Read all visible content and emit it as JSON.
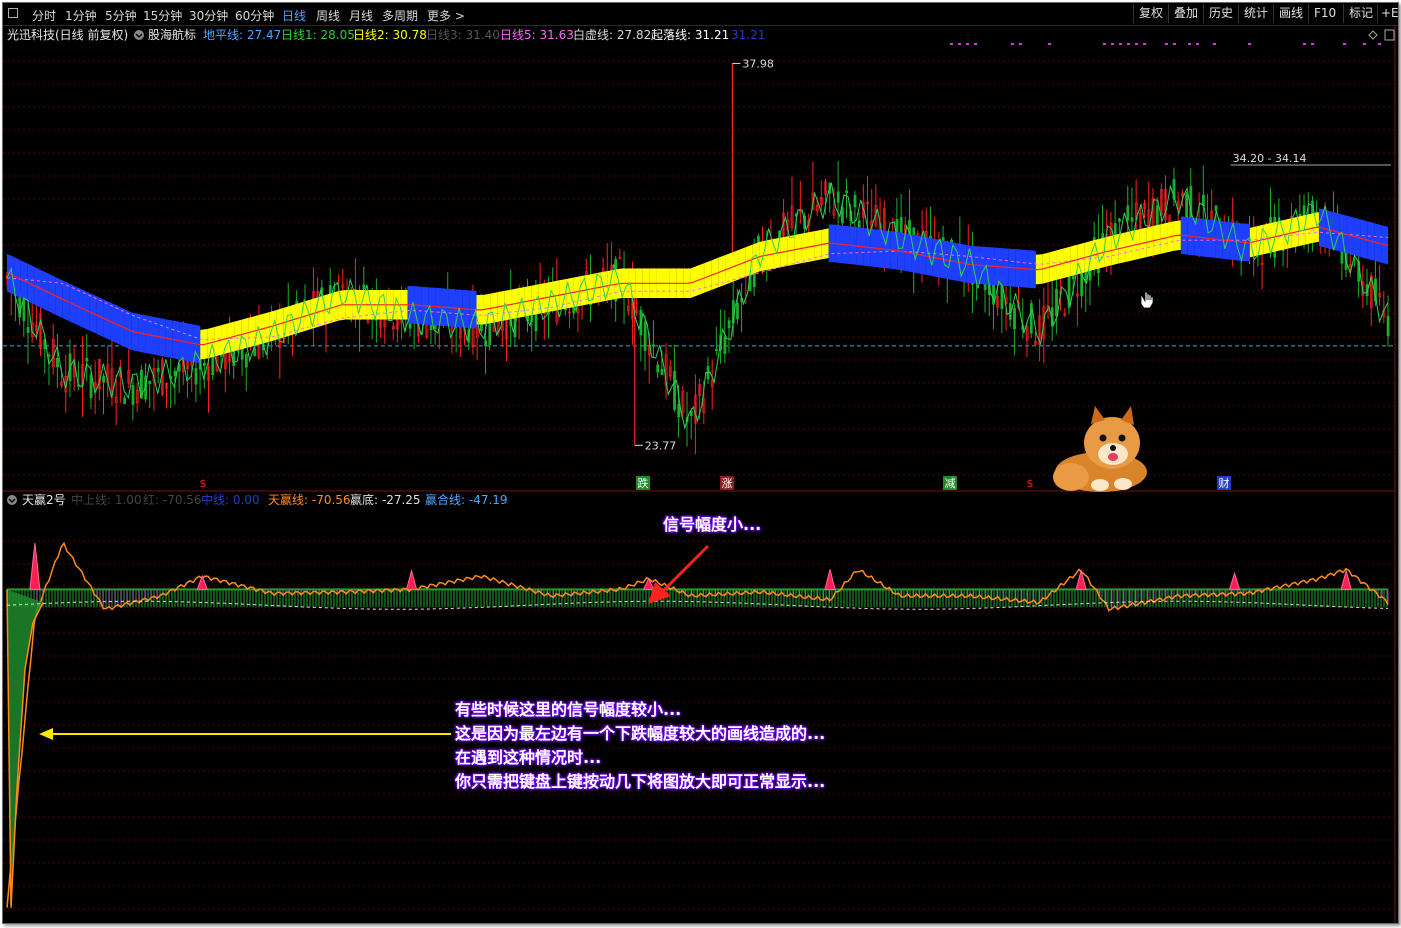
{
  "toolbar": {
    "timeframes": [
      "分时",
      "1分钟",
      "5分钟",
      "15分钟",
      "30分钟",
      "60分钟",
      "日线",
      "周线",
      "月线",
      "多周期",
      "更多 >"
    ],
    "active": "日线",
    "right_buttons": [
      "复权",
      "叠加",
      "历史",
      "统计",
      "画线",
      "F10",
      "标记",
      "+E"
    ]
  },
  "main_header": {
    "stock": "光迅科技(日线 前复权)",
    "indicator": "股海航标",
    "items": [
      {
        "label": "地平线: 27.47",
        "color": "#4da6ff"
      },
      {
        "label": "日线1: 28.05",
        "color": "#33cc33"
      },
      {
        "label": "日线2: 30.78",
        "color": "#ffff00"
      },
      {
        "label": "日线3: 31.40",
        "color": "#555555"
      },
      {
        "label": "日线5: 31.63",
        "color": "#ff66ff"
      },
      {
        "label": "白虚线: 27.82",
        "color": "#d8d8d8"
      },
      {
        "label": "起落线: 31.21",
        "color": "#ffffff"
      },
      {
        "label": "31.21",
        "color": "#1f3fbf"
      }
    ]
  },
  "sub_header": {
    "indicator": "天赢2号",
    "items": [
      {
        "label": "中上线: 1.00",
        "color": "#444444"
      },
      {
        "label": "红: -70.56",
        "color": "#444444"
      },
      {
        "label": "中线: 0.00",
        "color": "#1f3fbf"
      },
      {
        "label": "天赢线: -70.56",
        "color": "#ff8c1a"
      },
      {
        "label": "赢底: -27.25",
        "color": "#dddddd"
      },
      {
        "label": "赢合线: -47.19",
        "color": "#4da6ff"
      }
    ]
  },
  "chart_data": [
    {
      "type": "line",
      "name": "股海航标 (main K-line panel)",
      "x": [
        1,
        5,
        10,
        15,
        20,
        25,
        30,
        35,
        40,
        45,
        50,
        55,
        60,
        65,
        70,
        75,
        80,
        85,
        90,
        95,
        100
      ],
      "series": [
        {
          "name": "日线1",
          "values": [
            30.0,
            26.5,
            26.0,
            26.8,
            27.8,
            29.5,
            28.5,
            28.2,
            29.0,
            30.0,
            24.5,
            31.0,
            33.0,
            31.5,
            30.5,
            28.0,
            31.5,
            33.0,
            31.0,
            32.5,
            28.5
          ]
        },
        {
          "name": "起落线",
          "values": [
            30.2,
            29.2,
            28.0,
            27.5,
            28.2,
            29.0,
            29.0,
            28.8,
            29.3,
            29.8,
            29.8,
            30.8,
            31.3,
            31.0,
            30.5,
            30.3,
            31.0,
            31.6,
            31.3,
            31.9,
            31.2
          ]
        },
        {
          "name": "白虚线",
          "values": [
            30.0,
            29.8,
            28.6,
            27.7,
            27.8,
            28.5,
            28.8,
            28.6,
            28.9,
            29.5,
            29.5,
            30.2,
            30.9,
            31.0,
            30.8,
            30.5,
            30.8,
            31.4,
            31.4,
            31.7,
            31.5
          ]
        }
      ],
      "annotations": [
        {
          "label": "37.98",
          "x": 53
        },
        {
          "label": "23.77",
          "x": 46
        },
        {
          "label": "34.20 - 34.14",
          "x": 88
        }
      ],
      "markers": [
        "$",
        "跌",
        "涨",
        "减",
        "$",
        "财"
      ],
      "horizontal_line": 27.47
    },
    {
      "type": "bar",
      "name": "天赢2号 (sub indicator)",
      "x": [
        1,
        3,
        5,
        8,
        12,
        15,
        20,
        25,
        30,
        35,
        40,
        45,
        47,
        50,
        55,
        60,
        62,
        65,
        70,
        75,
        78,
        80,
        85,
        90,
        95,
        97,
        100
      ],
      "series": [
        {
          "name": "天赢线",
          "values": [
            -240,
            -20,
            35,
            -15,
            -5,
            10,
            -3,
            -2,
            0,
            10,
            -5,
            0,
            8,
            -5,
            -2,
            -8,
            15,
            -5,
            -5,
            -10,
            15,
            -15,
            -5,
            -3,
            8,
            15,
            -10
          ]
        }
      ]
    }
  ],
  "annotations": {
    "signal_small": "信号幅度小...",
    "note_lines": [
      "有些时候这里的信号幅度较小...",
      "这是因为最左边有一个下跌幅度较大的画线造成的...",
      "在遇到这种情况时...",
      "你只需把键盘上键按动几下将图放大即可正常显示..."
    ]
  },
  "colors": {
    "up": "#ff2020",
    "down": "#00e0e0",
    "bg": "#000000",
    "grid": "#5a0000",
    "band_up": "#ffff00",
    "band_down": "#1f3fff"
  }
}
